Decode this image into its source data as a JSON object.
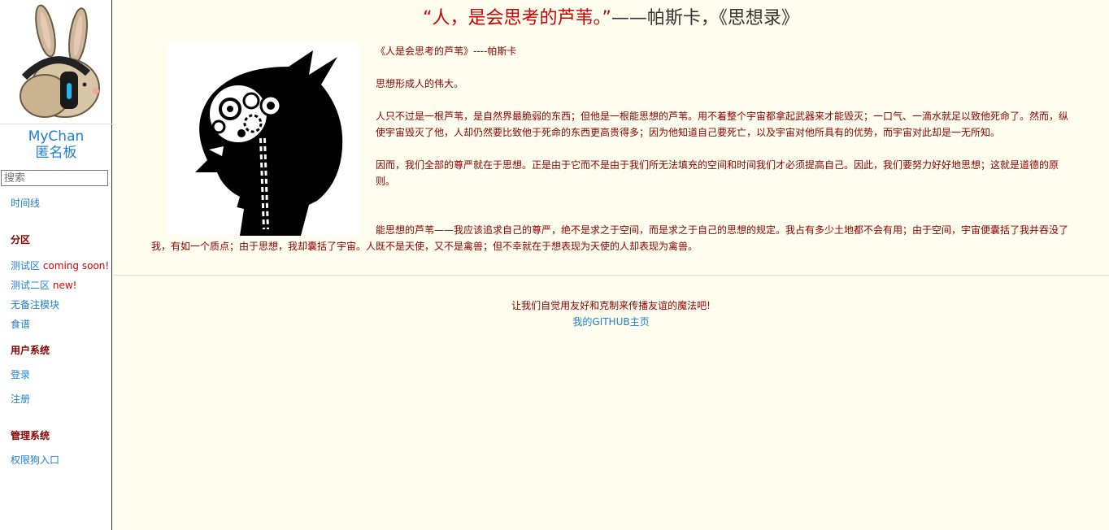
{
  "sidebar": {
    "site_name_1": "MyChan",
    "site_name_2": "匿名板",
    "search_placeholder": "搜索",
    "timeline": "时间线",
    "section_heading": "分区",
    "items": [
      {
        "label": "测试区",
        "tag": "coming soon!"
      },
      {
        "label": "测试二区",
        "tag": "new!"
      },
      {
        "label": "无备注模块",
        "tag": ""
      },
      {
        "label": "食谱",
        "tag": ""
      }
    ],
    "user_heading": "用户系统",
    "login": "登录",
    "register": "注册",
    "admin_heading": "管理系统",
    "admin_entry": "权限狗入口"
  },
  "main": {
    "title_quote": "“人，是会思考的芦苇。”",
    "title_author": "——帕斯卡，《思想录》",
    "article": {
      "p1": "《人是会思考的芦苇》----帕斯卡",
      "p2": "思想形成人的伟大。",
      "p3": "人只不过是一根芦苇，是自然界最脆弱的东西；但他是一根能思想的芦苇。用不着整个宇宙都拿起武器来才能毁灭；一口气、一滴水就足以致他死命了。然而，纵使宇宙毁灭了他，人却仍然要比致他于死命的东西更高贵得多；因为他知道自己要死亡，以及宇宙对他所具有的优势，而宇宙对此却是一无所知。",
      "p4": "因而，我们全部的尊严就在于思想。正是由于它而不是由于我们所无法填充的空间和时间我们才必须提高自己。因此，我们要努力好好地思想；这就是道德的原则。",
      "p5": "能思想的芦苇——我应该追求自己的尊严，绝不是求之于空间，而是求之于自己的思想的规定。我占有多少土地都不会有用；由于空间，宇宙便囊括了我并吞没了我，有如一个质点；由于思想，我却囊括了宇宙。人既不是天使，又不是禽兽；但不幸就在于想表现为天使的人却表现为禽兽。"
    }
  },
  "footer": {
    "message": "让我们自觉用友好和克制来传播友谊的魔法吧!",
    "github_link": "我的GITHUB主页"
  },
  "colors": {
    "accent_blue": "#1f7fd1",
    "dark_red": "#8b0000",
    "title_red": "#cc0000",
    "background": "#fffdee"
  }
}
